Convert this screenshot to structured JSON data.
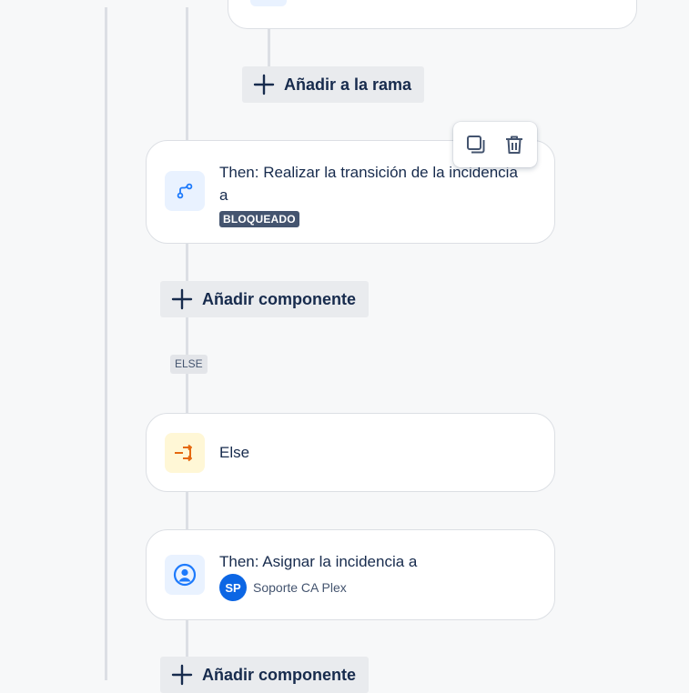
{
  "top_card": {
    "partial_text": "..."
  },
  "add_to_branch": {
    "label": "Añadir a la rama"
  },
  "toolbar": {
    "duplicate_icon": "copy-icon",
    "delete_icon": "trash-icon"
  },
  "transition_card": {
    "icon": "transition-icon",
    "text": "Then: Realizar la transición de la incidencia a",
    "status": "BLOQUEADO"
  },
  "add_component_1": {
    "label": "Añadir componente"
  },
  "else_tag": {
    "label": "ELSE"
  },
  "else_card": {
    "icon": "branch-icon",
    "text": "Else"
  },
  "assign_card": {
    "icon": "user-icon",
    "text": "Then: Asignar la incidencia a",
    "avatar_initials": "SP",
    "assignee": "Soporte CA Plex"
  },
  "add_component_2": {
    "label": "Añadir componente"
  },
  "colors": {
    "lozenge": "#44546f",
    "avatar": "#0c66e4",
    "icon_blue": "#1d7afc",
    "icon_orange": "#e56910"
  }
}
